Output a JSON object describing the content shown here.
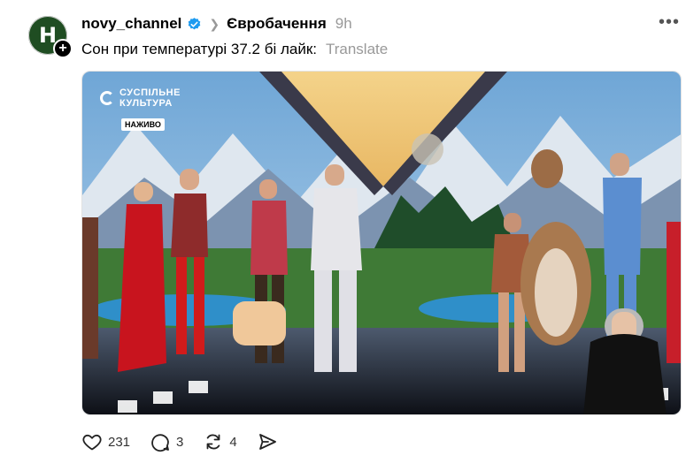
{
  "post": {
    "avatar_letter": "H",
    "follow_icon": "plus-icon",
    "username": "novy_channel",
    "verified_icon": "verified-badge-icon",
    "breadcrumb_separator_icon": "chevron-right-icon",
    "community": "Євробачення",
    "time": "9h",
    "more_icon": "more-horizontal-icon",
    "caption": "Сон при температурі 37.2 бі лайк:",
    "translate_label": "Translate"
  },
  "media": {
    "channel_name_line1": "СУСПІЛЬНЕ",
    "channel_name_line2": "КУЛЬТУРА",
    "live_badge": "НАЖИВО"
  },
  "actions": {
    "likes": "231",
    "comments": "3",
    "reposts": "4",
    "like_icon": "heart-icon",
    "comment_icon": "comment-icon",
    "repost_icon": "repost-icon",
    "share_icon": "share-icon"
  },
  "colors": {
    "verified_blue": "#1d9bf0",
    "secondary_text": "#999999",
    "avatar_bg": "#1f4d22"
  }
}
